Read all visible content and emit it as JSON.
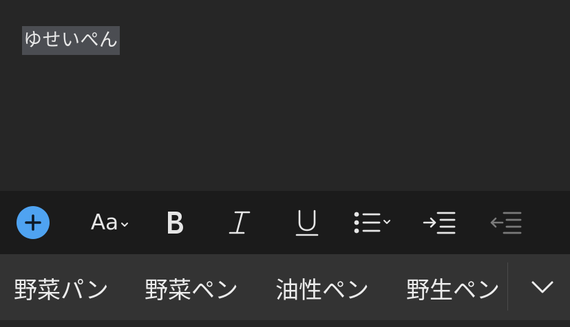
{
  "editor": {
    "composing_text": "ゆせいぺん"
  },
  "toolbar": {
    "items": [
      {
        "icon": "plus-icon",
        "color": "#4fa3f1"
      },
      {
        "label": "Aa",
        "icon": "chevron-down-icon"
      },
      {
        "icon": "bold-icon"
      },
      {
        "icon": "italic-icon"
      },
      {
        "icon": "underline-icon"
      },
      {
        "icon": "bulleted-list-icon"
      },
      {
        "icon": "indent-icon"
      },
      {
        "icon": "outdent-icon",
        "state": "disabled"
      }
    ]
  },
  "suggestions": {
    "items": [
      "野菜パン",
      "野菜ペン",
      "油性ペン",
      "野生ペン"
    ],
    "expand_icon": "chevron-down-icon"
  },
  "colors": {
    "editor_bg": "#262626",
    "selection_bg": "#4b4d52",
    "toolbar_bg": "#1b1b1b",
    "suggestion_bg": "#333333",
    "accent": "#4fa3f1"
  }
}
